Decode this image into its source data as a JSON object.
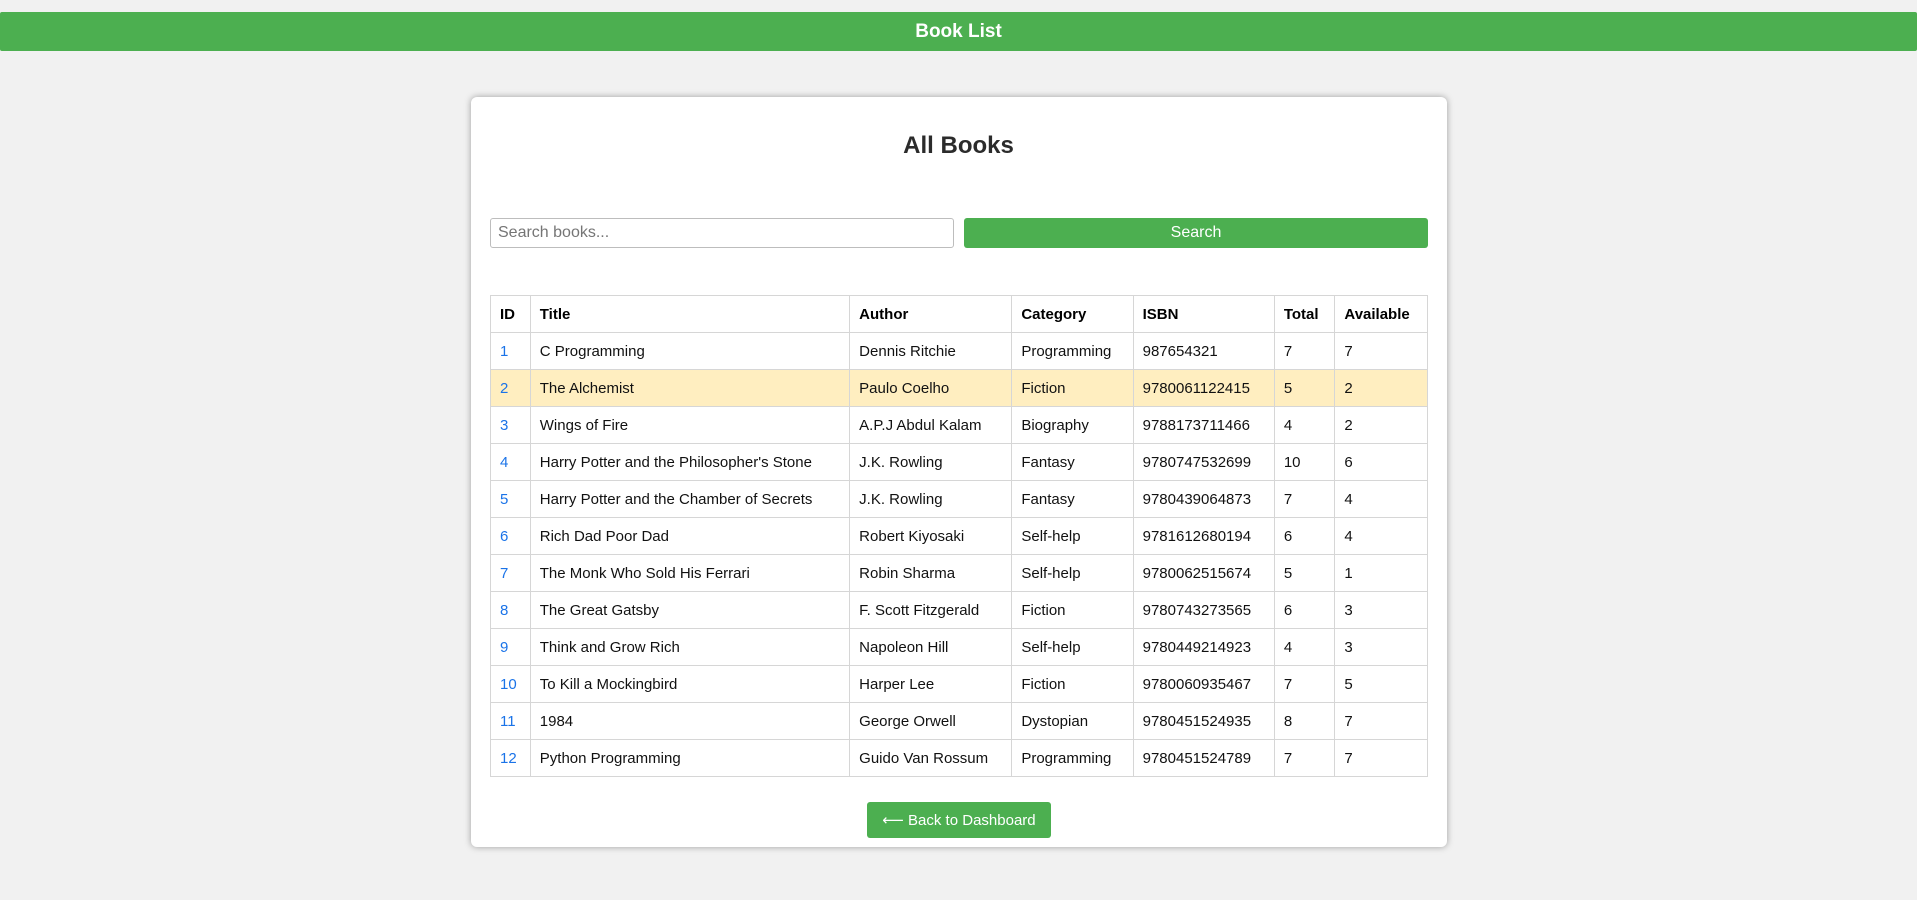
{
  "header": {
    "title": "Book List"
  },
  "main": {
    "title": "All Books",
    "search": {
      "placeholder": "Search books...",
      "value": "",
      "button_label": "Search"
    },
    "table": {
      "columns": [
        "ID",
        "Title",
        "Author",
        "Category",
        "ISBN",
        "Total",
        "Available"
      ],
      "highlighted_row": 1,
      "rows": [
        {
          "id": "1",
          "title": "C Programming",
          "author": "Dennis Ritchie",
          "category": "Programming",
          "isbn": "987654321",
          "total": "7",
          "available": "7"
        },
        {
          "id": "2",
          "title": "The Alchemist",
          "author": "Paulo Coelho",
          "category": "Fiction",
          "isbn": "9780061122415",
          "total": "5",
          "available": "2"
        },
        {
          "id": "3",
          "title": "Wings of Fire",
          "author": "A.P.J Abdul Kalam",
          "category": "Biography",
          "isbn": "9788173711466",
          "total": "4",
          "available": "2"
        },
        {
          "id": "4",
          "title": "Harry Potter and the Philosopher's Stone",
          "author": "J.K. Rowling",
          "category": "Fantasy",
          "isbn": "9780747532699",
          "total": "10",
          "available": "6"
        },
        {
          "id": "5",
          "title": "Harry Potter and the Chamber of Secrets",
          "author": "J.K. Rowling",
          "category": "Fantasy",
          "isbn": "9780439064873",
          "total": "7",
          "available": "4"
        },
        {
          "id": "6",
          "title": "Rich Dad Poor Dad",
          "author": "Robert Kiyosaki",
          "category": "Self-help",
          "isbn": "9781612680194",
          "total": "6",
          "available": "4"
        },
        {
          "id": "7",
          "title": "The Monk Who Sold His Ferrari",
          "author": "Robin Sharma",
          "category": "Self-help",
          "isbn": "9780062515674",
          "total": "5",
          "available": "1"
        },
        {
          "id": "8",
          "title": "The Great Gatsby",
          "author": "F. Scott Fitzgerald",
          "category": "Fiction",
          "isbn": "9780743273565",
          "total": "6",
          "available": "3"
        },
        {
          "id": "9",
          "title": "Think and Grow Rich",
          "author": "Napoleon Hill",
          "category": "Self-help",
          "isbn": "9780449214923",
          "total": "4",
          "available": "3"
        },
        {
          "id": "10",
          "title": "To Kill a Mockingbird",
          "author": "Harper Lee",
          "category": "Fiction",
          "isbn": "9780060935467",
          "total": "7",
          "available": "5"
        },
        {
          "id": "11",
          "title": "1984",
          "author": "George Orwell",
          "category": "Dystopian",
          "isbn": "9780451524935",
          "total": "8",
          "available": "7"
        },
        {
          "id": "12",
          "title": "Python Programming",
          "author": "Guido Van Rossum",
          "category": "Programming",
          "isbn": "9780451524789",
          "total": "7",
          "available": "7"
        }
      ]
    },
    "back_button_label": "⟵ Back to Dashboard"
  },
  "colors": {
    "accent": "#4caf50",
    "link": "#1a73e8",
    "highlight_row": "#ffeec0",
    "page_background": "#f1f1f1"
  }
}
